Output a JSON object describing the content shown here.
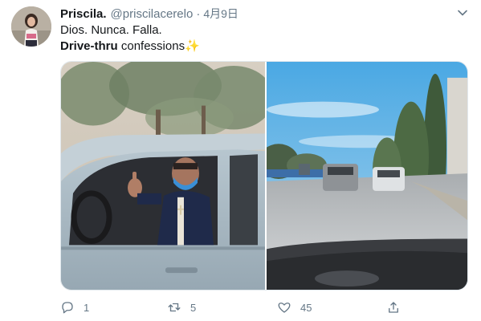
{
  "tweet": {
    "display_name": "Priscila.",
    "handle": "@priscilacerelo",
    "separator": "·",
    "date": "4月9日",
    "text_line1": "Dios. Nunca. Falla.",
    "text_line2_bold": "Drive-thru",
    "text_line2_rest": " confessions",
    "emoji": "✨"
  },
  "media": {
    "left_photo": "priest-in-car-thumbs-up",
    "right_photo": "road-with-cars-and-trees"
  },
  "actions": {
    "reply_count": "1",
    "retweet_count": "5",
    "like_count": "45"
  },
  "colors": {
    "text_primary": "#14171a",
    "text_secondary": "#657786",
    "border": "#e1e8ed",
    "emoji_sparkle": "#f5b92e"
  },
  "icons": {
    "reply": "reply-icon",
    "retweet": "retweet-icon",
    "like": "heart-icon",
    "share": "share-icon",
    "menu": "chevron-down-icon"
  }
}
